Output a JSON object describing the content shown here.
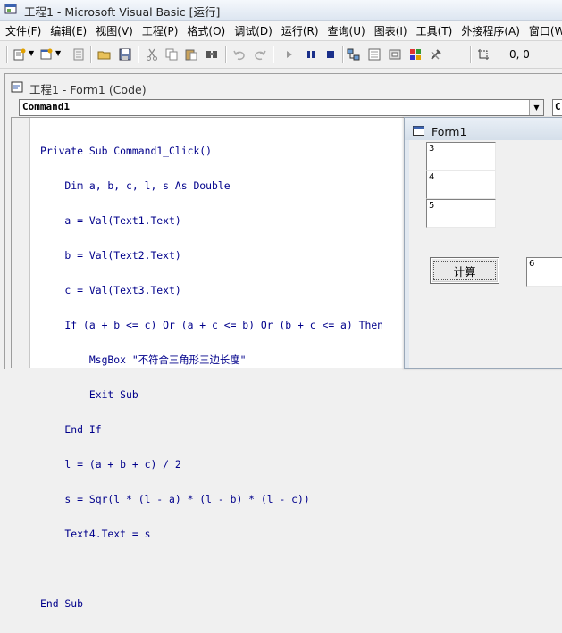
{
  "app": {
    "title": "工程1 - Microsoft Visual Basic [运行]"
  },
  "menu": [
    "文件(F)",
    "编辑(E)",
    "视图(V)",
    "工程(P)",
    "格式(O)",
    "调试(D)",
    "运行(R)",
    "查询(U)",
    "图表(I)",
    "工具(T)",
    "外接程序(A)",
    "窗口(W)"
  ],
  "toolbar": {
    "icons": [
      "add-project-icon",
      "add-form-icon",
      "menu-editor-icon",
      "open-icon",
      "save-icon",
      "cut-icon",
      "copy-icon",
      "paste-icon",
      "find-icon",
      "undo-icon",
      "redo-icon",
      "start-icon",
      "pause-icon",
      "stop-icon",
      "project-explorer-icon",
      "properties-icon",
      "form-layout-icon",
      "object-browser-icon",
      "toolbox-icon",
      "position-icon"
    ],
    "coords": "0, 0"
  },
  "code_window": {
    "title": "工程1 - Form1 (Code)",
    "object_combo": "Command1",
    "proc_combo": "C",
    "lines": [
      "Private Sub Command1_Click()",
      "    Dim a, b, c, l, s As Double",
      "    a = Val(Text1.Text)",
      "    b = Val(Text2.Text)",
      "    c = Val(Text3.Text)",
      "    If (a + b <= c) Or (a + c <= b) Or (b + c <= a) Then",
      "        MsgBox \"不符合三角形三边长度\"",
      "        Exit Sub",
      "    End If",
      "    l = (a + b + c) / 2",
      "    s = Sqr(l * (l - a) * (l - b) * (l - c))",
      "    Text4.Text = s",
      "",
      "End Sub"
    ]
  },
  "form1": {
    "title": "Form1",
    "text1": "3",
    "text2": "4",
    "text3": "5",
    "text4": "6",
    "button": "计算"
  },
  "colors": {
    "code_text": "#00008b",
    "title_bar": "#dde6f1"
  }
}
